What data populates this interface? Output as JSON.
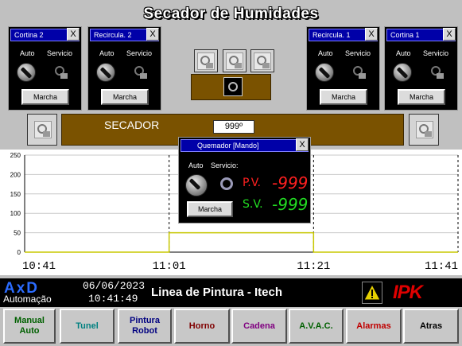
{
  "title": "Secador de Humidades",
  "colors": {
    "accent_blue": "#0000a8",
    "secador_brown": "#7a5200",
    "pv_red": "#ff2020",
    "sv_green": "#22dd22",
    "brand_red": "#e00000"
  },
  "popups": {
    "cortina2": {
      "title": "Cortina 2",
      "close": "X",
      "auto": "Auto",
      "servicio": "Servicio",
      "button": "Marcha"
    },
    "recircula2": {
      "title": "Recircula. 2",
      "close": "X",
      "auto": "Auto",
      "servicio": "Servicio",
      "button": "Marcha"
    },
    "recircula1": {
      "title": "Recircula. 1",
      "close": "X",
      "auto": "Auto",
      "servicio": "Servicio",
      "button": "Marcha"
    },
    "cortina1": {
      "title": "Cortina 1",
      "close": "X",
      "auto": "Auto",
      "servicio": "Servicio",
      "button": "Marcha"
    }
  },
  "secador": {
    "label": "SECADOR",
    "temperature": "999º"
  },
  "quemador": {
    "title": "Quemador [Mando]",
    "close": "X",
    "auto": "Auto",
    "servicio": "Servicio:",
    "button": "Marcha",
    "pv_label": "P.V.",
    "pv_value": "-999",
    "sv_label": "S.V.",
    "sv_value": "-999"
  },
  "chart_data": {
    "type": "line",
    "title": "",
    "xlabel": "",
    "ylabel": "",
    "y_ticks": [
      "250",
      "200",
      "150",
      "100",
      "50",
      "0"
    ],
    "x_ticks": [
      "10:41",
      "11:01",
      "11:21",
      "11:41"
    ],
    "ylim": [
      0,
      250
    ],
    "grid": true,
    "series": [
      {
        "color": "#c8c800",
        "x": [
          "10:41",
          "11:01",
          "11:01",
          "11:21",
          "11:21",
          "11:41"
        ],
        "values": [
          0,
          0,
          50,
          50,
          0,
          0
        ]
      }
    ]
  },
  "footer": {
    "brand": "AxD",
    "brand_sub": "Automação",
    "date": "06/06/2023",
    "time": "10:41:49",
    "line_name": "Linea de Pintura - Itech",
    "logo": "IPK"
  },
  "nav": [
    {
      "label": "Manual Auto",
      "color": "#006000"
    },
    {
      "label": "Tunel",
      "color": "#008080"
    },
    {
      "label": "Pintura Robot",
      "color": "#000080"
    },
    {
      "label": "Horno",
      "color": "#800000"
    },
    {
      "label": "Cadena",
      "color": "#800080"
    },
    {
      "label": "A.V.A.C.",
      "color": "#006000"
    },
    {
      "label": "Alarmas",
      "color": "#c00000"
    },
    {
      "label": "Atras",
      "color": "#000000"
    }
  ]
}
